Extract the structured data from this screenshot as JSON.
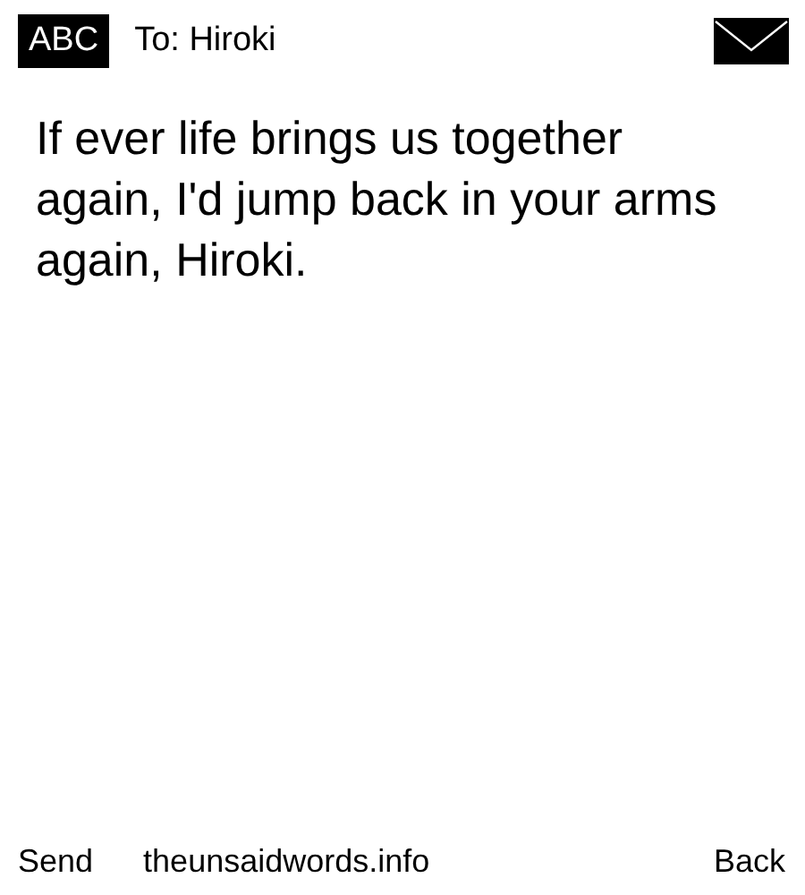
{
  "header": {
    "input_mode": "ABC",
    "recipient": "To: Hiroki"
  },
  "message": "If ever life brings us together again, I'd jump back in your arms again, Hiroki.",
  "softkeys": {
    "left": "Send",
    "center": "theunsaidwords.info",
    "right": "Back"
  }
}
